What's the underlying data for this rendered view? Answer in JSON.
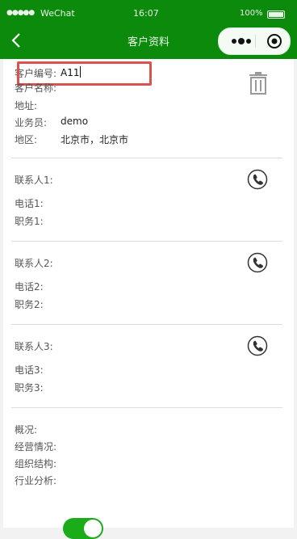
{
  "status_bar": {
    "signal": "●●●●●",
    "carrier": "WeChat",
    "time": "16:07",
    "battery_percent": "100%"
  },
  "nav": {
    "title": "客户资料"
  },
  "customer": {
    "code_label": "客户编号:",
    "code_value": "A11",
    "name_label": "客户名称:",
    "address_label": "地址:",
    "salesman_label": "业务员:",
    "salesman_value": "demo",
    "region_label": "地区:",
    "region_value": "北京市，北京市"
  },
  "contacts": [
    {
      "contact_label": "联系人1:",
      "phone_label": "电话1:",
      "position_label": "职务1:"
    },
    {
      "contact_label": "联系人2:",
      "phone_label": "电话2:",
      "position_label": "职务2:"
    },
    {
      "contact_label": "联系人3:",
      "phone_label": "电话3:",
      "position_label": "职务3:"
    }
  ],
  "overview": {
    "summary_label": "概况:",
    "operation_label": "经营情况:",
    "structure_label": "组织结构:",
    "industry_label": "行业分析:"
  },
  "colors": {
    "nav_green": "#0c8a0c",
    "toggle_green": "#1aad19",
    "highlight_red": "#d9534f"
  },
  "icons": [
    "back-arrow-icon",
    "more-icon",
    "close-circle-icon",
    "trash-icon",
    "phone-icon"
  ]
}
